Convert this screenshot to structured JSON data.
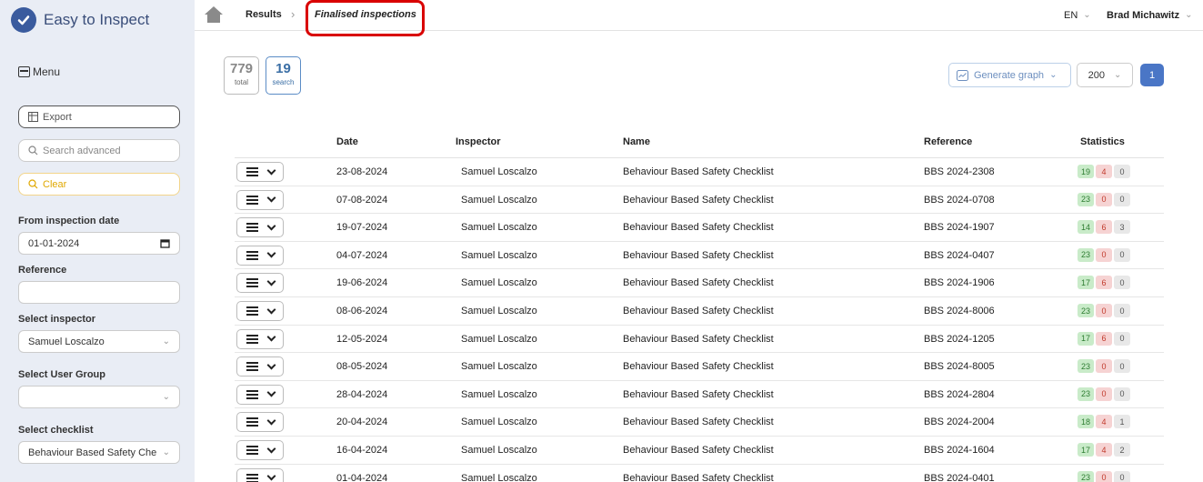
{
  "app": {
    "name": "Easy to Inspect"
  },
  "sidebar": {
    "menu_label": "Menu",
    "export_label": "Export",
    "search_placeholder": "Search advanced",
    "clear_label": "Clear",
    "from_date_label": "From inspection date",
    "from_date_value": "01-01-2024",
    "reference_label": "Reference",
    "reference_value": "",
    "inspector_label": "Select inspector",
    "inspector_value": "Samuel Loscalzo",
    "user_group_label": "Select User Group",
    "user_group_value": "",
    "checklist_label": "Select checklist",
    "checklist_value": "Behaviour Based Safety Che"
  },
  "breadcrumb": {
    "results": "Results",
    "current": "Finalised inspections"
  },
  "header": {
    "language": "EN",
    "user": "Brad Michawitz"
  },
  "counters": {
    "total_num": "779",
    "total_lbl": "total",
    "search_num": "19",
    "search_lbl": "search"
  },
  "controls": {
    "generate_graph": "Generate graph",
    "per_page": "200",
    "page": "1"
  },
  "table": {
    "headers": {
      "date": "Date",
      "inspector": "Inspector",
      "name": "Name",
      "reference": "Reference",
      "statistics": "Statistics"
    },
    "rows": [
      {
        "date": "23-08-2024",
        "inspector": "Samuel Loscalzo",
        "name": "Behaviour Based Safety Checklist",
        "reference": "BBS 2024-2308",
        "s1": "19",
        "s2": "4",
        "s3": "0"
      },
      {
        "date": "07-08-2024",
        "inspector": "Samuel Loscalzo",
        "name": "Behaviour Based Safety Checklist",
        "reference": "BBS 2024-0708",
        "s1": "23",
        "s2": "0",
        "s3": "0"
      },
      {
        "date": "19-07-2024",
        "inspector": "Samuel Loscalzo",
        "name": "Behaviour Based Safety Checklist",
        "reference": "BBS 2024-1907",
        "s1": "14",
        "s2": "6",
        "s3": "3"
      },
      {
        "date": "04-07-2024",
        "inspector": "Samuel Loscalzo",
        "name": "Behaviour Based Safety Checklist",
        "reference": "BBS 2024-0407",
        "s1": "23",
        "s2": "0",
        "s3": "0"
      },
      {
        "date": "19-06-2024",
        "inspector": "Samuel Loscalzo",
        "name": "Behaviour Based Safety Checklist",
        "reference": "BBS 2024-1906",
        "s1": "17",
        "s2": "6",
        "s3": "0"
      },
      {
        "date": "08-06-2024",
        "inspector": "Samuel Loscalzo",
        "name": "Behaviour Based Safety Checklist",
        "reference": "BBS 2024-8006",
        "s1": "23",
        "s2": "0",
        "s3": "0"
      },
      {
        "date": "12-05-2024",
        "inspector": "Samuel Loscalzo",
        "name": "Behaviour Based Safety Checklist",
        "reference": "BBS 2024-1205",
        "s1": "17",
        "s2": "6",
        "s3": "0"
      },
      {
        "date": "08-05-2024",
        "inspector": "Samuel Loscalzo",
        "name": "Behaviour Based Safety Checklist",
        "reference": "BBS 2024-8005",
        "s1": "23",
        "s2": "0",
        "s3": "0"
      },
      {
        "date": "28-04-2024",
        "inspector": "Samuel Loscalzo",
        "name": "Behaviour Based Safety Checklist",
        "reference": "BBS 2024-2804",
        "s1": "23",
        "s2": "0",
        "s3": "0"
      },
      {
        "date": "20-04-2024",
        "inspector": "Samuel Loscalzo",
        "name": "Behaviour Based Safety Checklist",
        "reference": "BBS 2024-2004",
        "s1": "18",
        "s2": "4",
        "s3": "1"
      },
      {
        "date": "16-04-2024",
        "inspector": "Samuel Loscalzo",
        "name": "Behaviour Based Safety Checklist",
        "reference": "BBS 2024-1604",
        "s1": "17",
        "s2": "4",
        "s3": "2"
      },
      {
        "date": "01-04-2024",
        "inspector": "Samuel Loscalzo",
        "name": "Behaviour Based Safety Checklist",
        "reference": "BBS 2024-0401",
        "s1": "23",
        "s2": "0",
        "s3": "0"
      }
    ]
  }
}
